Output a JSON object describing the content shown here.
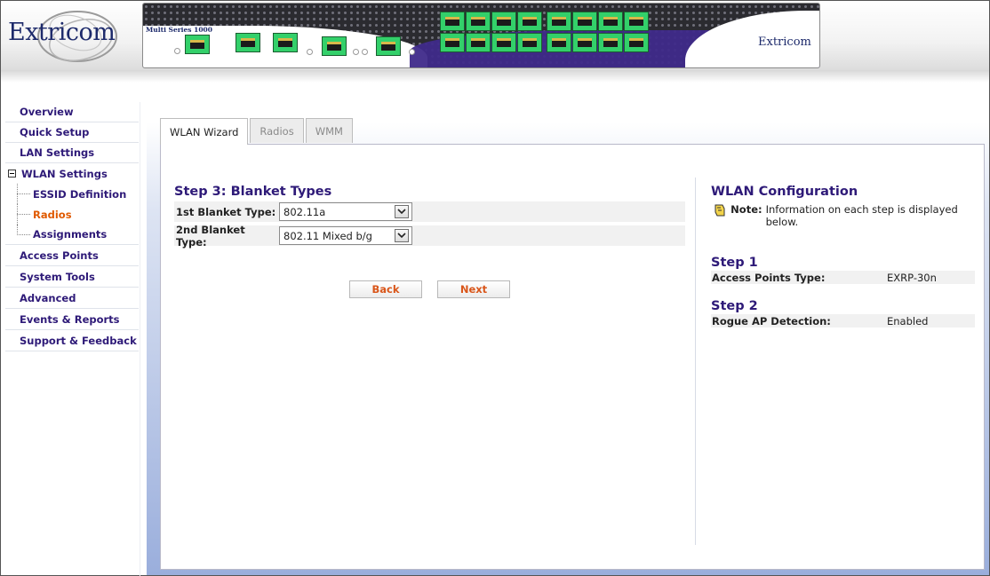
{
  "header": {
    "logo_text": "Extricom",
    "device": {
      "model": "Multi Series 1000",
      "logo_text": "Extricom"
    }
  },
  "sidebar": {
    "items": [
      {
        "label": "Overview"
      },
      {
        "label": "Quick Setup"
      },
      {
        "label": "LAN Settings"
      },
      {
        "label": "WLAN Settings",
        "expanded": true
      },
      {
        "label": "ESSID Definition"
      },
      {
        "label": "Radios",
        "active": true
      },
      {
        "label": "Assignments"
      },
      {
        "label": "Access Points"
      },
      {
        "label": "System Tools"
      },
      {
        "label": "Advanced"
      },
      {
        "label": "Events & Reports"
      },
      {
        "label": "Support & Feedback"
      }
    ]
  },
  "tabs": [
    {
      "label": "WLAN Wizard",
      "active": true
    },
    {
      "label": "Radios"
    },
    {
      "label": "WMM"
    }
  ],
  "wizard": {
    "title": "Step 3: Blanket Types",
    "fields": [
      {
        "label": "1st Blanket Type:",
        "value": "802.11a"
      },
      {
        "label": "2nd Blanket Type:",
        "value": "802.11 Mixed b/g"
      }
    ],
    "back_label": "Back",
    "next_label": "Next"
  },
  "config": {
    "title": "WLAN Configuration",
    "note_label": "Note:",
    "note_text": "Information on each step is displayed below.",
    "steps": [
      {
        "title": "Step 1",
        "key": "Access Points Type:",
        "value": "EXRP-30n"
      },
      {
        "title": "Step 2",
        "key": "Rogue AP Detection:",
        "value": "Enabled"
      }
    ]
  },
  "colors": {
    "nav_text": "#2e1a78",
    "active_nav": "#e05a00",
    "button_text": "#d9561a",
    "brand": "#1d2a6b"
  }
}
